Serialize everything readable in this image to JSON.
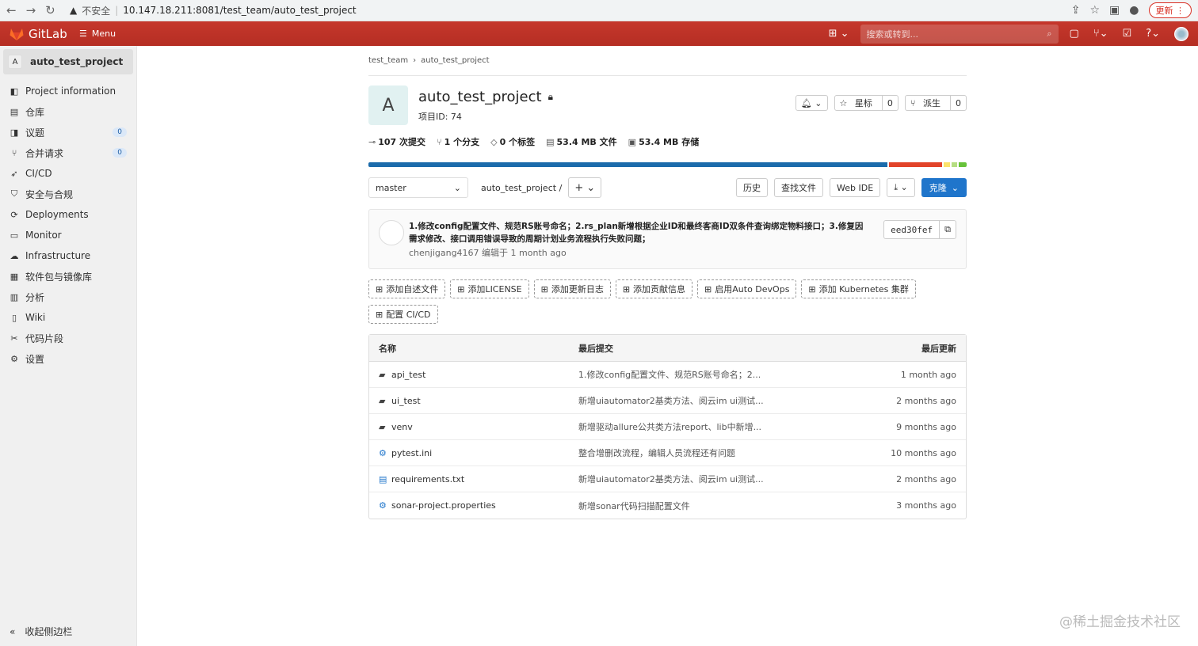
{
  "browser": {
    "insecure_label": "不安全",
    "url": "10.147.18.211:8081/test_team/auto_test_project",
    "update_label": "更新"
  },
  "topbar": {
    "brand": "GitLab",
    "menu_label": "Menu",
    "search_placeholder": "搜索或转到..."
  },
  "sidebar": {
    "project_letter": "A",
    "project_name": "auto_test_project",
    "items": [
      {
        "label": "Project information",
        "icon": "info-icon"
      },
      {
        "label": "仓库",
        "icon": "repo-icon"
      },
      {
        "label": "议题",
        "icon": "issues-icon",
        "badge": "0"
      },
      {
        "label": "合并请求",
        "icon": "merge-icon",
        "badge": "0"
      },
      {
        "label": "CI/CD",
        "icon": "rocket-icon"
      },
      {
        "label": "安全与合规",
        "icon": "shield-icon"
      },
      {
        "label": "Deployments",
        "icon": "deploy-icon"
      },
      {
        "label": "Monitor",
        "icon": "monitor-icon"
      },
      {
        "label": "Infrastructure",
        "icon": "cloud-icon"
      },
      {
        "label": "软件包与镜像库",
        "icon": "package-icon"
      },
      {
        "label": "分析",
        "icon": "chart-icon"
      },
      {
        "label": "Wiki",
        "icon": "book-icon"
      },
      {
        "label": "代码片段",
        "icon": "scissors-icon"
      },
      {
        "label": "设置",
        "icon": "gear-icon"
      }
    ],
    "collapse_label": "收起侧边栏"
  },
  "breadcrumb": [
    "test_team",
    "auto_test_project"
  ],
  "project": {
    "letter": "A",
    "title": "auto_test_project",
    "id_label": "项目ID: 74",
    "notify_icon": "bell-icon",
    "star_label": "星标",
    "star_count": "0",
    "fork_label": "派生",
    "fork_count": "0"
  },
  "stats": [
    {
      "icon": "commit-icon",
      "value": "107",
      "label": "次提交"
    },
    {
      "icon": "branch-icon",
      "value": "1",
      "label": "个分支"
    },
    {
      "icon": "tag-icon",
      "value": "0",
      "label": "个标签"
    },
    {
      "icon": "file-icon",
      "value": "53.4 MB",
      "label": "文件"
    },
    {
      "icon": "storage-icon",
      "value": "53.4 MB",
      "label": "存储"
    }
  ],
  "languages": [
    {
      "fraction": 0.877,
      "color": "#1b6bab"
    },
    {
      "fraction": 0.09,
      "color": "#e24329"
    },
    {
      "fraction": 0.01,
      "color": "#fbe36b"
    },
    {
      "fraction": 0.01,
      "color": "#b5dd82"
    },
    {
      "fraction": 0.013,
      "color": "#67c23a"
    }
  ],
  "toolbar": {
    "branch": "master",
    "path": "auto_test_project",
    "path_sep": "/",
    "history": "历史",
    "find_file": "查找文件",
    "web_ide": "Web IDE",
    "clone": "克隆"
  },
  "commit": {
    "message": "1.修改config配置文件、规范RS账号命名；2.rs_plan新增根据企业ID和最终客商ID双条件查询绑定物料接口；3.修复因需求修改、接口调用错误导致的周期计划业务流程执行失败问题；",
    "author": "chenjigang4167",
    "edited": "编辑于 1 month ago",
    "sha": "eed30fef"
  },
  "shortcuts": [
    "添加自述文件",
    "添加LICENSE",
    "添加更新日志",
    "添加贡献信息",
    "启用Auto DevOps",
    "添加 Kubernetes 集群",
    "配置 CI/CD"
  ],
  "tree": {
    "headers": {
      "name": "名称",
      "commit": "最后提交",
      "date": "最后更新"
    },
    "rows": [
      {
        "icon": "folder-icon",
        "name": "api_test",
        "commit": "1.修改config配置文件、规范RS账号命名；2...",
        "date": "1 month ago"
      },
      {
        "icon": "folder-icon",
        "name": "ui_test",
        "commit": "新增uiautomator2基类方法、阅云im ui测试...",
        "date": "2 months ago"
      },
      {
        "icon": "folder-icon",
        "name": "venv",
        "commit": "新增驱动allure公共类方法report、lib中新增...",
        "date": "9 months ago"
      },
      {
        "icon": "config-icon",
        "name": "pytest.ini",
        "commit": "整合增删改流程，编辑人员流程还有问题",
        "date": "10 months ago"
      },
      {
        "icon": "text-file-icon",
        "name": "requirements.txt",
        "commit": "新增uiautomator2基类方法、阅云im ui测试...",
        "date": "2 months ago"
      },
      {
        "icon": "config-icon",
        "name": "sonar-project.properties",
        "commit": "新增sonar代码扫描配置文件",
        "date": "3 months ago"
      }
    ]
  },
  "watermark": "@稀土掘金技术社区"
}
